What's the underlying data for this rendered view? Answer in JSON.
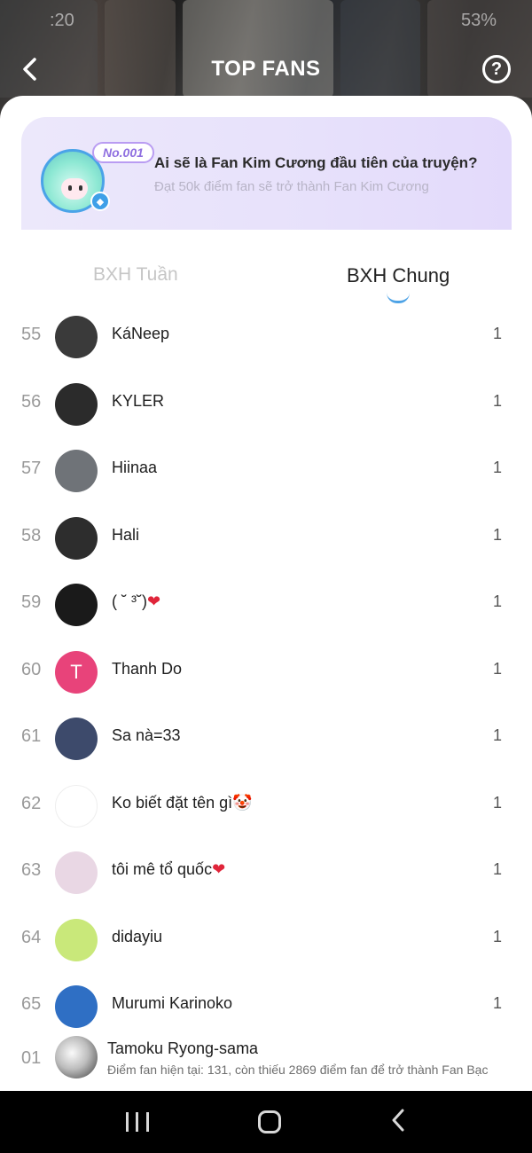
{
  "status_bar": {
    "time": ":20",
    "battery": "53%"
  },
  "header": {
    "title": "TOP FANS"
  },
  "banner": {
    "badge": "No.001",
    "title": "Ai sẽ là Fan Kim Cương đầu tiên của truyện?",
    "subtitle": "Đạt 50k điểm fan sẽ trở thành Fan Kim Cương"
  },
  "tabs": [
    {
      "label": "BXH Tuần"
    },
    {
      "label": "BXH Chung"
    }
  ],
  "fans": [
    {
      "rank": "55",
      "name": "KáNeep",
      "score": "1",
      "avatar_color": "#3a3a3a"
    },
    {
      "rank": "56",
      "name": "KYLER",
      "score": "1",
      "avatar_color": "#2b2b2b"
    },
    {
      "rank": "57",
      "name": "Hiinaa",
      "score": "1",
      "avatar_color": "#6f7378"
    },
    {
      "rank": "58",
      "name": "Hali",
      "score": "1",
      "avatar_color": "#2d2d2d"
    },
    {
      "rank": "59",
      "name": "( ˘ ³˘)",
      "suffix": "❤",
      "score": "1",
      "avatar_color": "#1a1a1a"
    },
    {
      "rank": "60",
      "name": "Thanh Do",
      "score": "1",
      "avatar_color": "#e8437a",
      "initial": "T"
    },
    {
      "rank": "61",
      "name": "Sa nà=33",
      "score": "1",
      "avatar_color": "#3d4a6b"
    },
    {
      "rank": "62",
      "name": "Ko biết đặt tên gì",
      "suffix": "🤡",
      "score": "1",
      "avatar_color": "#ffffff"
    },
    {
      "rank": "63",
      "name": "tôi mê tổ quốc",
      "suffix": "❤",
      "score": "1",
      "avatar_color": "#e9d7e4"
    },
    {
      "rank": "64",
      "name": "didayiu",
      "score": "1",
      "avatar_color": "#c9e87a"
    },
    {
      "rank": "65",
      "name": "Murumi Karinoko",
      "score": "1",
      "avatar_color": "#2f6fc4"
    }
  ],
  "me": {
    "rank": "01",
    "name": "Tamoku Ryong-sama",
    "subtitle": "Điểm fan hiện tại: 131, còn thiếu 2869 điểm fan để trở thành Fan Bạc"
  }
}
